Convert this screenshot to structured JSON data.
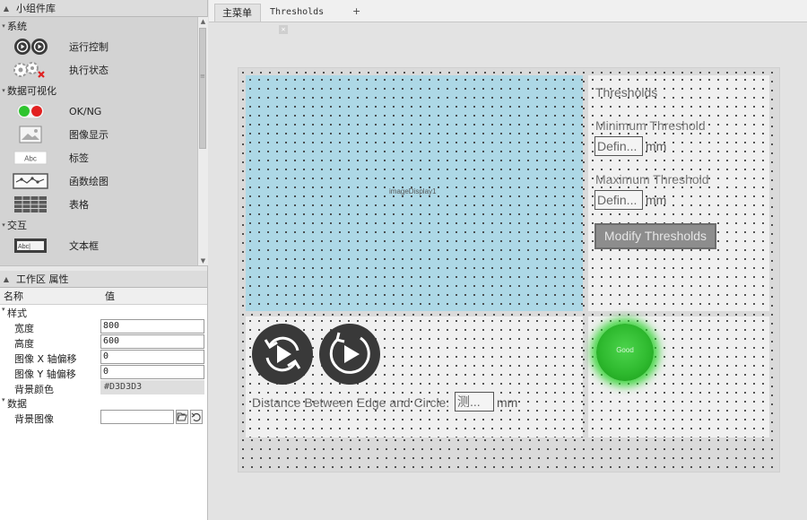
{
  "widget_library": {
    "title": "小组件库",
    "categories": [
      {
        "name": "系统",
        "items": [
          {
            "label": "运行控制",
            "icon": "run-control-icon"
          },
          {
            "label": "执行状态",
            "icon": "exec-status-icon"
          }
        ]
      },
      {
        "name": "数据可视化",
        "items": [
          {
            "label": "OK/NG",
            "icon": "ok-ng-icon"
          },
          {
            "label": "图像显示",
            "icon": "image-display-icon"
          },
          {
            "label": "标签",
            "icon": "label-icon",
            "preview": "Abc"
          },
          {
            "label": "函数绘图",
            "icon": "function-plot-icon"
          },
          {
            "label": "表格",
            "icon": "table-icon"
          }
        ]
      },
      {
        "name": "交互",
        "items": [
          {
            "label": "文本框",
            "icon": "textbox-icon",
            "preview": "Abc|"
          }
        ]
      }
    ]
  },
  "properties": {
    "title": "工作区 属性",
    "col_name": "名称",
    "col_value": "值",
    "groups": [
      {
        "name": "样式",
        "rows": [
          {
            "name": "宽度",
            "value": "800"
          },
          {
            "name": "高度",
            "value": "600"
          },
          {
            "name": "图像 X 轴偏移",
            "value": "0"
          },
          {
            "name": "图像 Y 轴偏移",
            "value": "0"
          },
          {
            "name": "背景颜色",
            "value": "#D3D3D3"
          }
        ]
      },
      {
        "name": "数据",
        "rows": [
          {
            "name": "背景图像",
            "value": ""
          }
        ]
      }
    ]
  },
  "tabs": [
    {
      "label": "主菜单",
      "active": true
    },
    {
      "label": "Thresholds",
      "active": false
    }
  ],
  "tab_add": "+",
  "canvas": {
    "image_display_label": "imageDisplay1",
    "thresholds": {
      "title": "Thresholds",
      "min_label": "Minimum Threshold",
      "min_value": "Defin...",
      "max_label": "Maximum Threshold",
      "max_value": "Defin...",
      "unit": "mm",
      "modify_button": "Modify Thresholds"
    },
    "distance": {
      "label": "Distance Between Edge and Circle:",
      "value": "测...",
      "unit": "mm"
    },
    "status_led": "Good"
  },
  "colors": {
    "image_display_bg": "#ADD8E6",
    "led_green": "#2FBA2F",
    "canvas_bg": "#D3D3D3"
  }
}
